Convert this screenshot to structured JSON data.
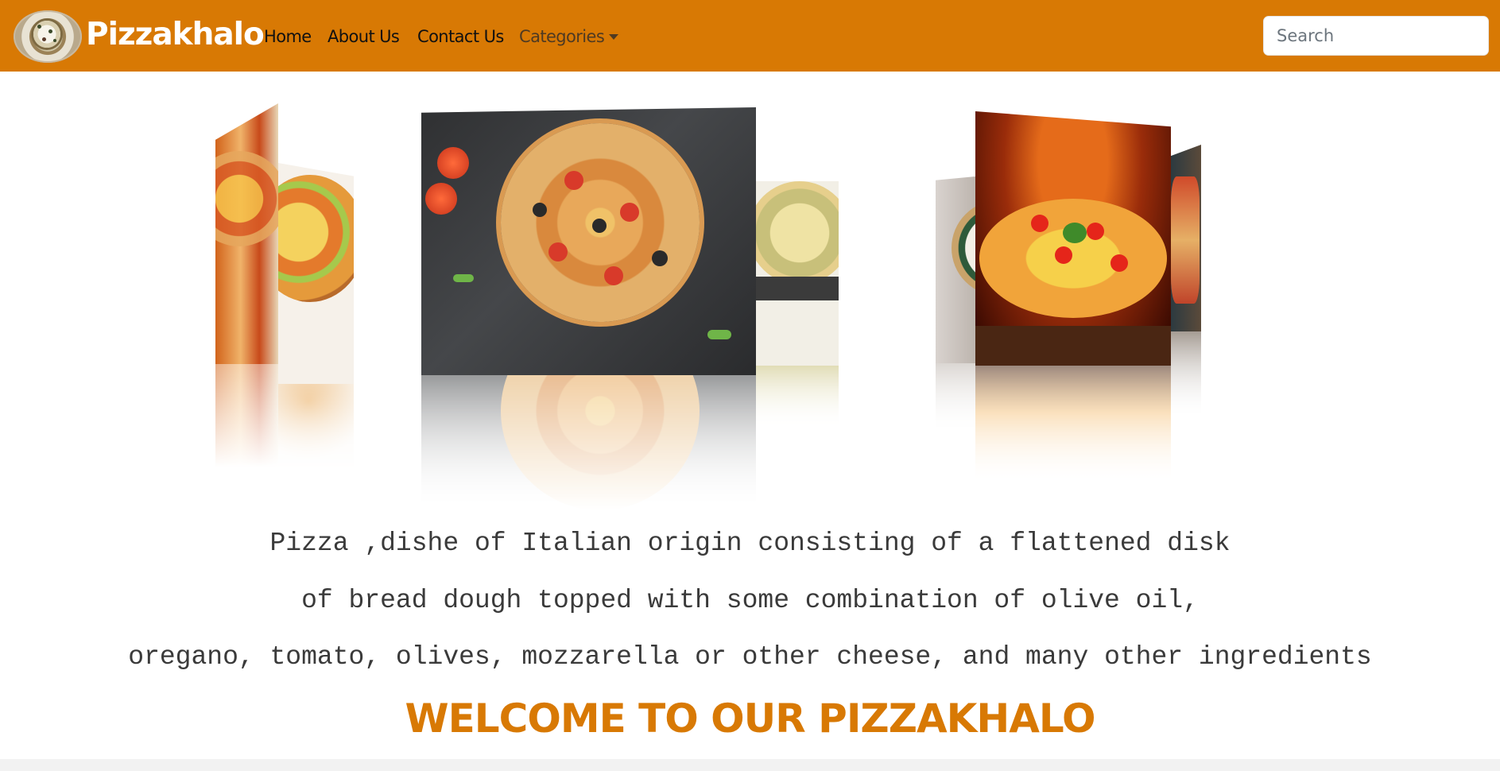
{
  "nav": {
    "brand": "Pizzakhalo",
    "links": [
      "Home",
      "About Us",
      "Contact Us"
    ],
    "dropdown_label": "Categories",
    "search": {
      "placeholder": "Search",
      "value": ""
    }
  },
  "description": {
    "line1": "Pizza ,dishe of Italian origin consisting of a flattened disk",
    "line2": "of bread dough topped with some combination of olive oil,",
    "line3": "oregano, tomato, olives, mozzarella or other cheese, and many other ingredients"
  },
  "welcome": "WELCOME TO OUR PIZZAKHALO",
  "colors": {
    "brand": "#d87904",
    "nav_text": "#111111",
    "welcome": "#d87904"
  },
  "icons": {
    "logo": "pizza-logo-icon",
    "dropdown": "caret-down-icon"
  }
}
